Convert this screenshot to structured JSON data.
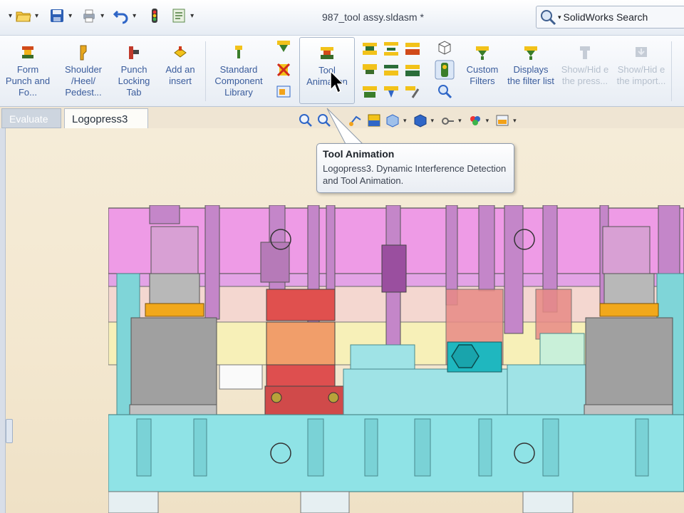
{
  "window": {
    "document_title": "987_tool assy.sldasm *",
    "search_label": "SolidWorks Search"
  },
  "quick_access": [
    {
      "icon": "open-folder-icon"
    },
    {
      "icon": "save-icon"
    },
    {
      "icon": "print-icon"
    },
    {
      "icon": "undo-icon"
    },
    {
      "icon": "rebuild-icon"
    },
    {
      "icon": "file-properties-icon"
    }
  ],
  "ribbon": {
    "buttons": [
      {
        "id": "form-punch",
        "label": "Form Punch and Fo..."
      },
      {
        "id": "shoulder",
        "label": "Shoulder /Heel/ Pedest..."
      },
      {
        "id": "punch-locking-tab",
        "label": "Punch Locking Tab"
      },
      {
        "id": "add-insert",
        "label": "Add an insert"
      },
      {
        "id": "standard-component-library",
        "label": "Standard Component Library"
      },
      {
        "id": "tool-animation",
        "label": "Tool Animation"
      },
      {
        "id": "custom-filters",
        "label": "Custom Filters"
      },
      {
        "id": "displays-filter-list",
        "label": "Displays the filter list"
      },
      {
        "id": "show-hide-press",
        "label": "Show/Hid e the press..."
      },
      {
        "id": "show-hide-import",
        "label": "Show/Hid e the import..."
      }
    ]
  },
  "tabs": {
    "evaluate": "Evaluate",
    "logopress": "Logopress3"
  },
  "tooltip": {
    "title": "Tool Animation",
    "body": "Logopress3. Dynamic Interference Detection and Tool Animation."
  },
  "colors": {
    "ribbon_text": "#3a5c9c",
    "viewport_bg": "#f3e7cf",
    "upper_plate": "#ee9be6",
    "lower_plate": "#8fe3e6",
    "guide_post": "#9a9a9a",
    "bushing": "#f1a81b",
    "red_block": "#e0504e"
  }
}
